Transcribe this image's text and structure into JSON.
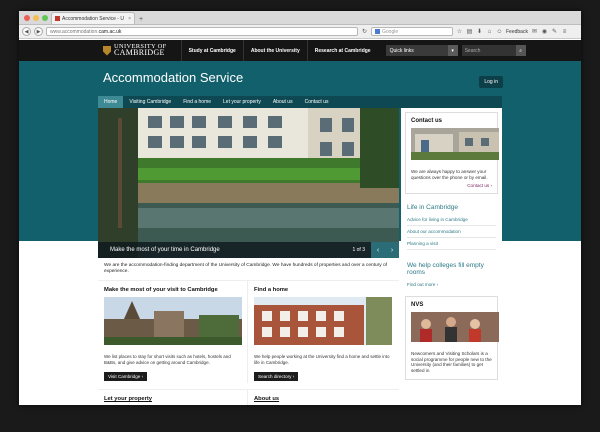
{
  "browser": {
    "tab_title": "Accommodation Service - U",
    "tab_close": "×",
    "new_tab": "+",
    "url_prefix": "www.accommodation.",
    "url_domain": "cam.ac.uk",
    "search_placeholder": "Google",
    "feedback": "Feedback"
  },
  "university": {
    "logo_line1": "UNIVERSITY OF",
    "logo_line2": "CAMBRIDGE",
    "nav": [
      "Study at Cambridge",
      "About the University",
      "Research at Cambridge"
    ],
    "quick_links": "Quick links",
    "search_placeholder": "Search"
  },
  "site": {
    "title": "Accommodation Service",
    "login": "Log in",
    "subnav": [
      "Home",
      "Visiting Cambridge",
      "Find a home",
      "Let your property",
      "About us",
      "Contact us"
    ]
  },
  "hero": {
    "caption": "Make the most of your time in Cambridge",
    "pager": "1 of 3"
  },
  "sidebar": {
    "contact_title": "Contact us",
    "contact_text": "We are always happy to answer your questions over the phone or by email.",
    "contact_link": "Contact us ›",
    "life_title": "Life in Cambridge",
    "life_links": [
      "Advice for living in Cambridge",
      "About our accommodation",
      "Planning a visit"
    ],
    "colleges_title": "We help colleges fill empty rooms",
    "colleges_link": "Find out more ›",
    "nvs_title": "NVS",
    "nvs_text": "Newcomers and Visiting Scholars is a social programme for people new to the University (and their families) to get settled in"
  },
  "main": {
    "intro": "We are the accommodation-finding department of the University of Cambridge. We have hundreds of properties and over a century of experience.",
    "col1_title": "Make the most of your visit to Cambridge",
    "col1_text": "We list places to stay for short visits such as hotels, hostels and B&Bs, and give advice on getting around Cambridge.",
    "col1_button": "Visit Cambridge ›",
    "col2_title": "Find a home",
    "col2_text": "We help people working at the University find a home and settle into life in Cambridge.",
    "col2_button": "Search directory ›",
    "col3_title": "Let your property",
    "col4_title": "About us"
  }
}
